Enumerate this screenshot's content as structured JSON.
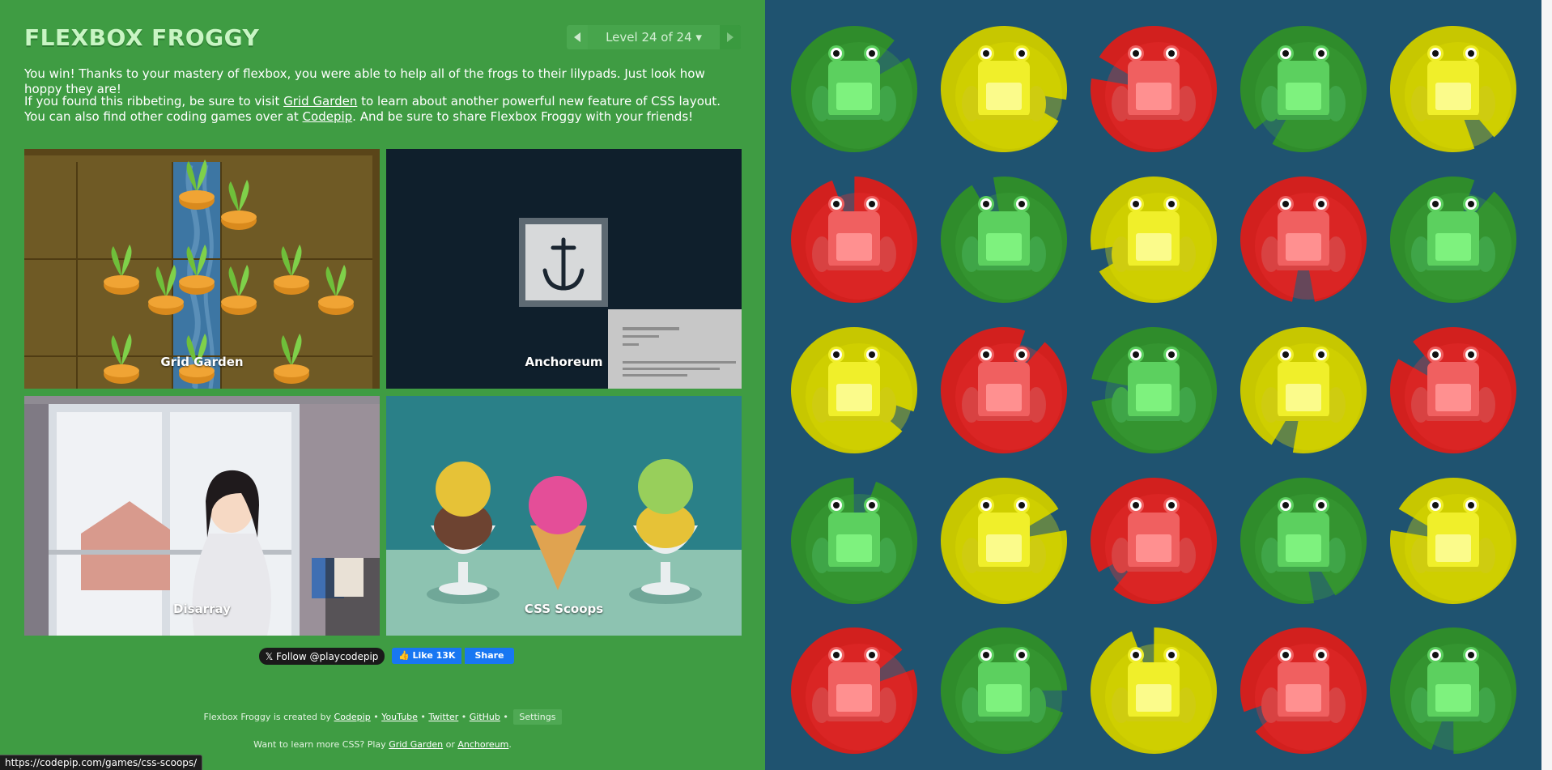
{
  "app": {
    "title": "FLEXBOX FROGGY"
  },
  "level_nav": {
    "indicator": "Level 24 of 24 ▾"
  },
  "text": {
    "win": "You win! Thanks to your mastery of flexbox, you were able to help all of the frogs to their lilypads. Just look how hoppy they are!",
    "visit_before": "If you found this ribbeting, be sure to visit ",
    "visit_link": "Grid Garden",
    "visit_middle": " to learn about another powerful new feature of CSS layout. You can also find other coding games over at ",
    "visit_link2": "Codepip",
    "visit_after": ". And be sure to share Flexbox Froggy with your friends!"
  },
  "games": [
    {
      "label": "Grid Garden"
    },
    {
      "label": "Anchoreum"
    },
    {
      "label": "Disarray"
    },
    {
      "label": "CSS Scoops"
    }
  ],
  "social": {
    "x_follow": "𝕏 Follow @playcodepip",
    "fb_like": "👍 Like 13K",
    "fb_share": "Share"
  },
  "credits": {
    "prefix": "Flexbox Froggy is created by ",
    "codepip": "Codepip",
    "youtube": "YouTube",
    "twitter": "Twitter",
    "github": "GitHub",
    "sep": " • ",
    "settings": "Settings"
  },
  "more_css": {
    "prefix": "Want to learn more CSS? Play ",
    "grid_garden": "Grid Garden",
    "or": " or ",
    "anchoreum": "Anchoreum",
    "suffix": "."
  },
  "status_bar": {
    "url": "https://codepip.com/games/css-scoops/"
  },
  "colors": {
    "sidebar_bg": "#3f9c43",
    "pond_bg": "#1f5370",
    "green": "#2e8b2f",
    "yellow": "#c8c700",
    "red": "#d62a26"
  },
  "pond": {
    "rows": [
      [
        "green",
        "yellow",
        "red",
        "green",
        "yellow"
      ],
      [
        "red",
        "green",
        "yellow",
        "red",
        "green"
      ],
      [
        "yellow",
        "red",
        "green",
        "yellow",
        "red"
      ],
      [
        "green",
        "yellow",
        "red",
        "green",
        "yellow"
      ],
      [
        "red",
        "green",
        "yellow",
        "red",
        "green"
      ]
    ]
  }
}
